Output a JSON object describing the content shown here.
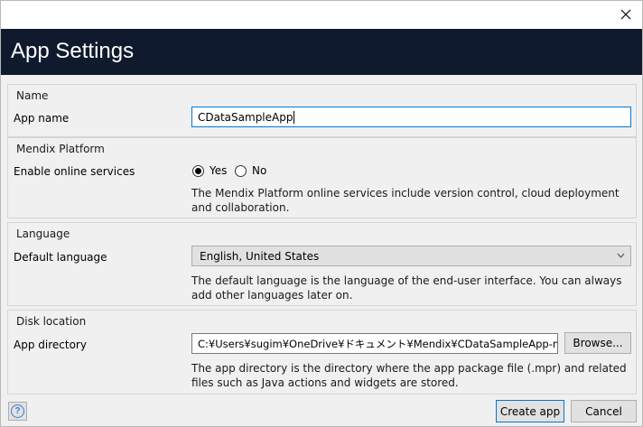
{
  "window": {
    "close_icon": "close-icon"
  },
  "banner": {
    "title": "App Settings",
    "background": "#101a2e"
  },
  "sections": {
    "name": {
      "title": "Name",
      "app_name_label": "App name",
      "app_name_value": "CDataSampleApp"
    },
    "platform": {
      "title": "Mendix Platform",
      "online_label": "Enable online services",
      "yes_label": "Yes",
      "no_label": "No",
      "selected": "Yes",
      "help": "The Mendix Platform online services include version control, cloud deployment and collaboration."
    },
    "language": {
      "title": "Language",
      "default_label": "Default language",
      "selected_value": "English, United States",
      "help": "The default language is the language of the end-user interface. You can always add other languages later on."
    },
    "disk": {
      "title": "Disk location",
      "dir_label": "App directory",
      "dir_value": "C:¥Users¥sugim¥OneDrive¥ドキュメント¥Mendix¥CDataSampleApp-main",
      "browse_label": "Browse...",
      "help": "The app directory is the directory where the app package file (.mpr) and related files such as Java actions and widgets are stored."
    }
  },
  "footer": {
    "help_label": "?",
    "create_label": "Create app",
    "cancel_label": "Cancel"
  },
  "colors": {
    "accent": "#0078d7",
    "banner": "#101a2e"
  }
}
